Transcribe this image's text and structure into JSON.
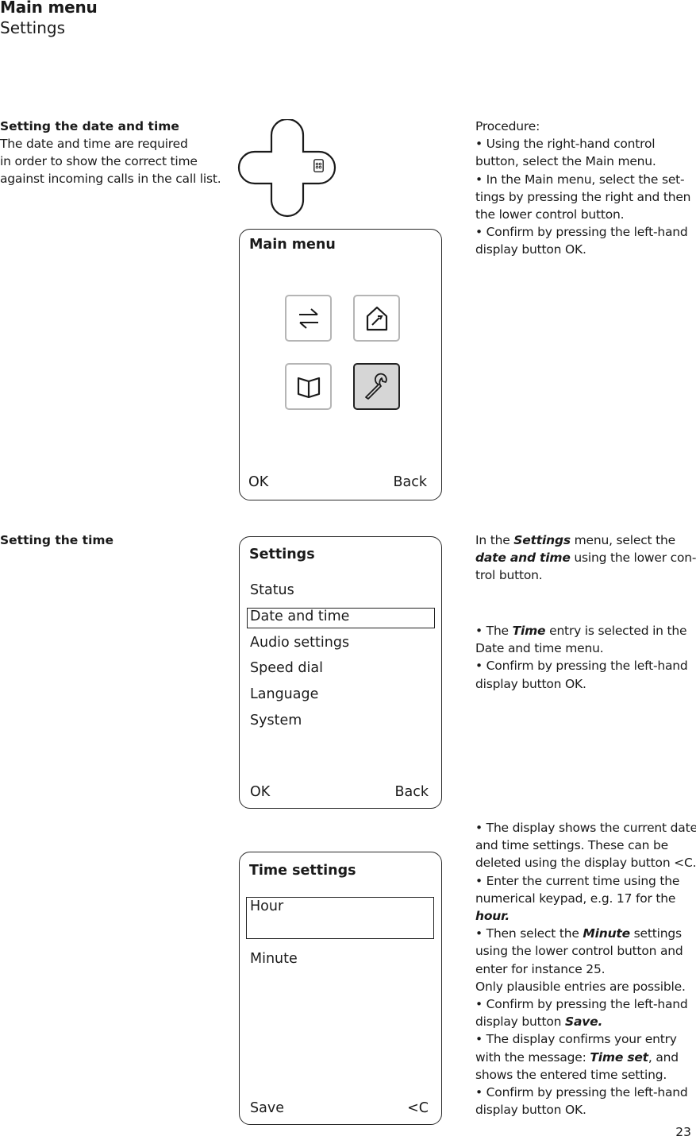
{
  "header": {
    "title": "Main menu",
    "subtitle": "Settings"
  },
  "section1": {
    "heading": "Setting the date and time",
    "description_lines": [
      "The date and time are required",
      "in order to show the correct time",
      "against incoming calls in the call list."
    ],
    "procedure_label": "Procedure:",
    "steps": [
      "• Using the right-hand control button, select the Main menu.",
      "• In the Main menu, select the set-tings by pressing the right and then the lower control button.",
      "• Confirm by pressing the left-hand display button OK."
    ],
    "control_pad": {
      "icon": "keypad-icon",
      "highlighted_button": "right"
    },
    "main_menu_screen": {
      "title": "Main menu",
      "tiles": [
        {
          "icon": "transfer-arrows-icon",
          "selected": false
        },
        {
          "icon": "house-wrench-icon",
          "selected": false
        },
        {
          "icon": "open-book-icon",
          "selected": false
        },
        {
          "icon": "wrench-icon",
          "selected": true
        }
      ],
      "softkey_left": "OK",
      "softkey_right": "Back"
    }
  },
  "section2": {
    "heading": "Setting the time",
    "para1": {
      "t1": "In the ",
      "b1": "Settings",
      "t2": " menu, select the ",
      "b2": "date and time",
      "t3": " using the lower con-trol button."
    },
    "para2": {
      "t1": "• The ",
      "b1": "Time",
      "t2": " entry is selected in the Date and time menu."
    },
    "para3": "• Confirm by pressing the left-hand display button OK.",
    "settings_screen": {
      "title": "Settings",
      "items": [
        "Status",
        "Date and time",
        "Audio settings",
        "Speed dial",
        "Language",
        "System"
      ],
      "selected_index": 1,
      "softkey_left": "OK",
      "softkey_right": "Back"
    }
  },
  "section3": {
    "p1": "• The display shows the current date and time settings. These can be deleted using the display button <C.",
    "p2": {
      "t1": "• Enter the current time using the numerical keypad, e.g. 17 for the ",
      "b1": "hour."
    },
    "p3": {
      "t1": "• Then select the ",
      "b1": "Minute",
      "t2": " settings using the lower control button and enter for instance 25."
    },
    "p4": "Only plausible entries are possible.",
    "p5": {
      "t1": "• Confirm by pressing the left-hand display button ",
      "b1": "Save."
    },
    "p6": {
      "t1": "• The display confirms your entry with the message: ",
      "b1": "Time set",
      "t2": ", and shows the entered time setting."
    },
    "p7": "• Confirm by pressing the left-hand display button OK.",
    "time_screen": {
      "title": "Time settings",
      "fields": [
        {
          "label": "Hour",
          "value": "",
          "selected": true
        },
        {
          "label": "Minute",
          "value": "",
          "selected": false
        }
      ],
      "softkey_left": "Save",
      "softkey_right": "<C"
    }
  },
  "page_number": "23"
}
